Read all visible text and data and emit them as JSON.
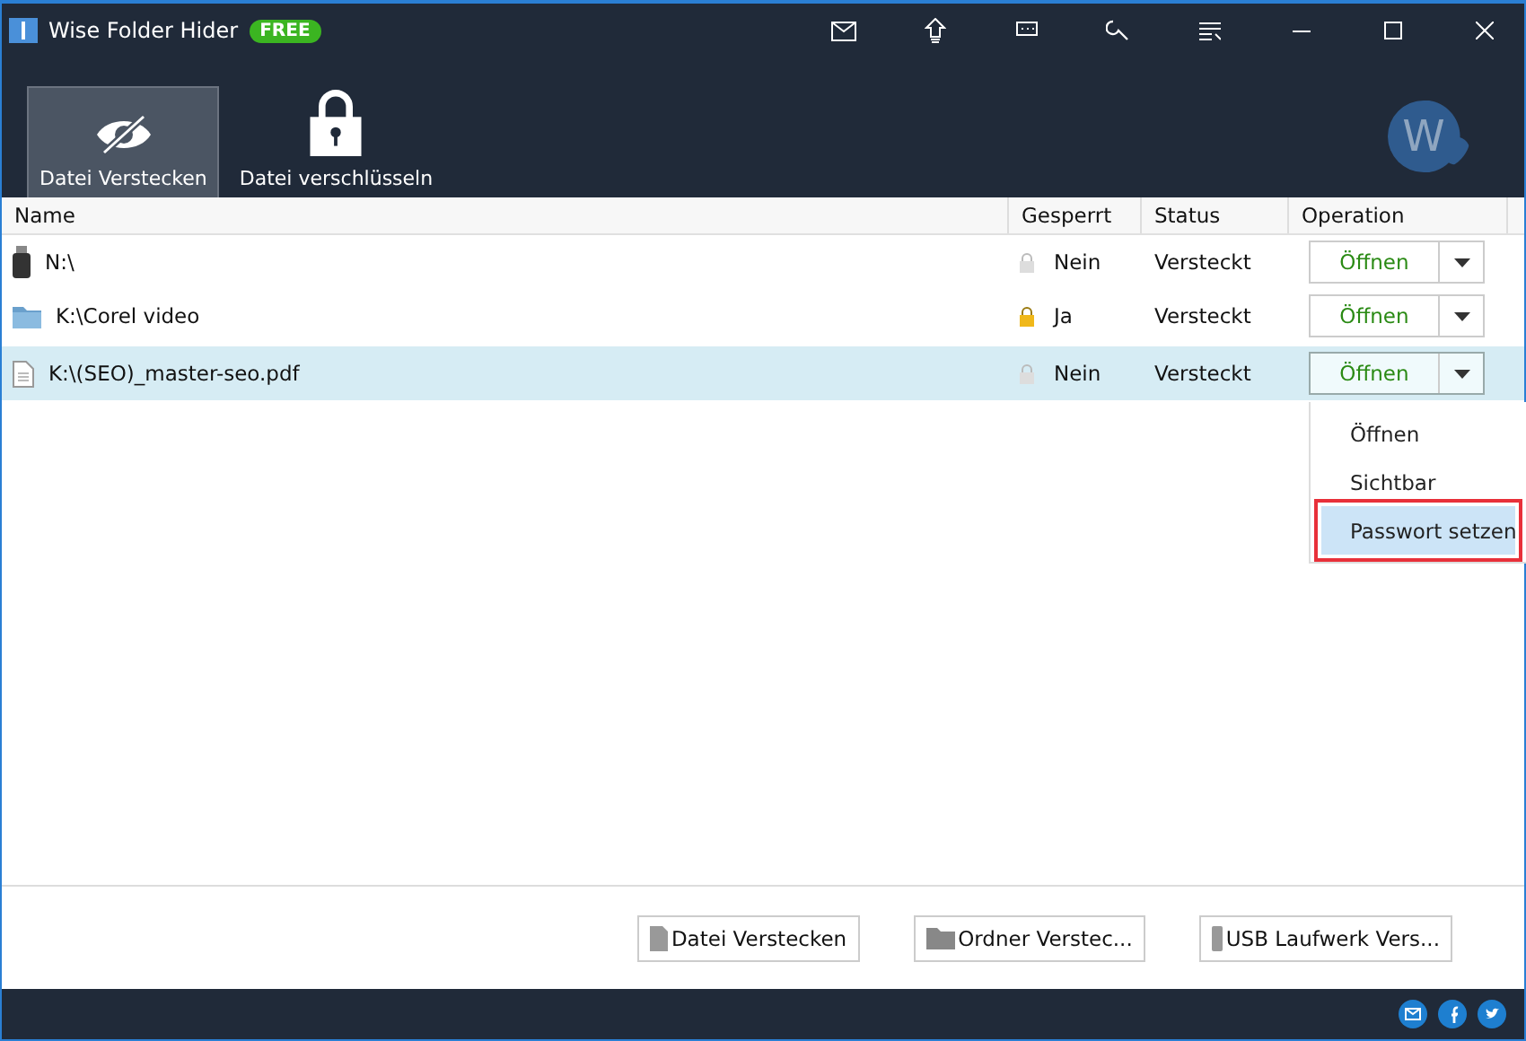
{
  "window": {
    "title": "Wise Folder Hider",
    "badge": "FREE"
  },
  "tabs": [
    {
      "label": "Datei Verstecken",
      "kind": "hide",
      "selected": true
    },
    {
      "label": "Datei verschlüsseln",
      "kind": "lock",
      "selected": false
    }
  ],
  "avatar": {
    "letter": "W"
  },
  "table": {
    "columns": [
      "Name",
      "Gesperrt",
      "Status",
      "Operation"
    ],
    "rows": [
      {
        "kind": "usb",
        "name": "N:\\",
        "locked": false,
        "locked_label": "Nein",
        "status": "Versteckt",
        "action": "Öffnen",
        "selected": false
      },
      {
        "kind": "folder",
        "name": "K:\\Corel video",
        "locked": true,
        "locked_label": "Ja",
        "status": "Versteckt",
        "action": "Öffnen",
        "selected": false
      },
      {
        "kind": "file",
        "name": "K:\\(SEO)_master-seo.pdf",
        "locked": false,
        "locked_label": "Nein",
        "status": "Versteckt",
        "action": "Öffnen",
        "selected": true
      }
    ]
  },
  "menu": {
    "items": [
      {
        "label": "Öffnen",
        "selected": false,
        "highlighted": false
      },
      {
        "label": "Sichtbar",
        "selected": false,
        "highlighted": false
      },
      {
        "label": "Passwort setzen",
        "selected": true,
        "highlighted": true
      }
    ]
  },
  "buttons": [
    {
      "kind": "file",
      "label": "Datei Verstecken"
    },
    {
      "kind": "folder",
      "label": "Ordner Verstec..."
    },
    {
      "kind": "usb",
      "label": "USB Laufwerk Vers..."
    }
  ]
}
